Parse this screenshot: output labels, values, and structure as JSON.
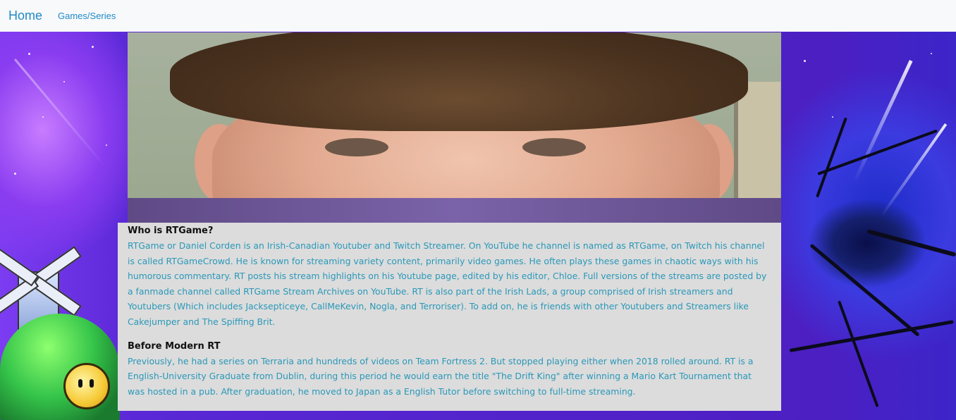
{
  "navbar": {
    "brand": "Home",
    "links": [
      "Games/Series"
    ]
  },
  "sections": [
    {
      "heading": "Who is RTGame?",
      "body": "RTGame or Daniel Corden is an Irish-Canadian Youtuber and Twitch Streamer. On YouTube he channel is named as RTGame, on Twitch his channel is called RTGameCrowd. He is known for streaming variety content, primarily video games. He often plays these games in chaotic ways with his humorous commentary. RT posts his stream highlights on his Youtube page, edited by his editor, Chloe. Full versions of the streams are posted by a fanmade channel called RTGame Stream Archives on YouTube. RT is also part of the Irish Lads, a group comprised of Irish streamers and Youtubers (Which includes Jacksepticeye, CallMeKevin, Nogla, and Terroriser). To add on, he is friends with other Youtubers and Streamers like Cakejumper and The Spiffing Brit."
    },
    {
      "heading": "Before Modern RT",
      "body": "Previously, he had a series on Terraria and hundreds of videos on Team Fortress 2. But stopped playing either when 2018 rolled around. RT is a English-University Graduate from Dublin, during this period he would earn the title \"The Drift King\" after winning a Mario Kart Tournament that was hosted in a pub. After graduation, he moved to Japan as a English Tutor before switching to full-time streaming."
    }
  ],
  "colors": {
    "link": "#1f8ac9",
    "body_text": "#2a98b8",
    "content_bg": "#dcdcdc",
    "navbar_bg": "#f8f9fa"
  }
}
